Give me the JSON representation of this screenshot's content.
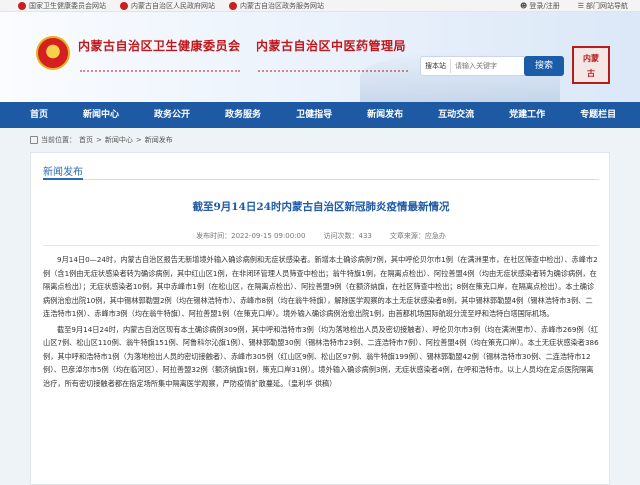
{
  "topbar": {
    "links": [
      {
        "label": "国家卫生健康委员会网站",
        "icon": "link-icon"
      },
      {
        "label": "内蒙古自治区人民政府网站",
        "icon": "link-icon"
      },
      {
        "label": "内蒙古自治区政务服务网站",
        "icon": "link-icon"
      }
    ],
    "right": [
      {
        "label": "登录/注册",
        "icon": "user-icon"
      },
      {
        "label": "部门网站导航",
        "icon": "menu-icon"
      }
    ]
  },
  "header": {
    "title1": "内蒙古自治区卫生健康委员会",
    "title2": "内蒙古自治区中医药管理局",
    "search_scope": "搜本站",
    "search_placeholder": "请输入关键字",
    "search_button": "搜索",
    "seal_text": "内蒙古"
  },
  "nav": {
    "items": [
      "首页",
      "新闻中心",
      "政务公开",
      "政务服务",
      "卫健指导",
      "新闻发布",
      "互动交流",
      "党建工作",
      "专题栏目"
    ]
  },
  "breadcrumb": {
    "prefix": "当前位置：",
    "items": [
      "首页",
      "新闻中心",
      "新闻发布"
    ],
    "separator": ">"
  },
  "article": {
    "section": "新闻发布",
    "title": "截至9月14日24时内蒙古自治区新冠肺炎疫情最新情况",
    "time": "发布时间：2022-09-15 09:00:00",
    "views": "访问次数：433",
    "source": "文章来源：应急办",
    "paragraphs": [
      "9月14日0—24时，内蒙古自治区报告无新增境外输入确诊病例和无症状感染者。新增本土确诊病例7例，其中呼伦贝尔市1例（在满洲里市，在社区筛查中检出）、赤峰市2例（含1例由无症状感染者转为确诊病例，其中红山区1例，在非闭环管理人员筛查中检出；翁牛特旗1例，在隔离点检出）、阿拉善盟4例（均由无症状感染者转为确诊病例，在隔离点检出）；无症状感染者10例，其中赤峰市1例（在松山区，在隔离点检出）、阿拉善盟9例（在额济纳旗，在社区筛查中检出；8例在策克口岸，在隔离点检出）。本土确诊病例治愈出院10例，其中锡林郭勒盟2例（均在锡林浩特市）、赤峰市8例（均在翁牛特旗），解除医学观察的本土无症状感染者8例，其中锡林郭勒盟4例（锡林浩特市3例、二连浩特市1例）、赤峰市3例（均在翁牛特旗）、阿拉善盟1例（在策克口岸）。境外输入确诊病例治愈出院1例，由首都机场国际航班分流至呼和浩特白塔国际机场。",
      "截至9月14日24时，内蒙古自治区现有本土确诊病例309例，其中呼和浩特市3例（均为落地检出人员及密切接触者）、呼伦贝尔市3例（均在满洲里市）、赤峰市269例（红山区7例、松山区110例、翁牛特旗151例、阿鲁科尔沁旗1例）、锡林郭勒盟30例（锡林浩特市23例、二连浩特市7例）、阿拉善盟4例（均在策克口岸）。本土无症状感染者386例，其中呼和浩特市1例（为落地检出人员的密切接触者）、赤峰市305例（红山区9例、松山区97例、翁牛特旗199例）、锡林郭勒盟42例（锡林浩特市30例、二连浩特市12例）、巴彦淖尔市5例（均在临河区）、阿拉善盟32例（额济纳旗1例，策克口岸31例）。境外输入确诊病例3例，无症状感染者4例，在呼和浩特市。以上人员均在定点医院隔离治疗，所有密切接触者都在指定场所集中隔离医学观察，严防疫情扩散蔓延。（皇利华 供稿）"
    ]
  }
}
